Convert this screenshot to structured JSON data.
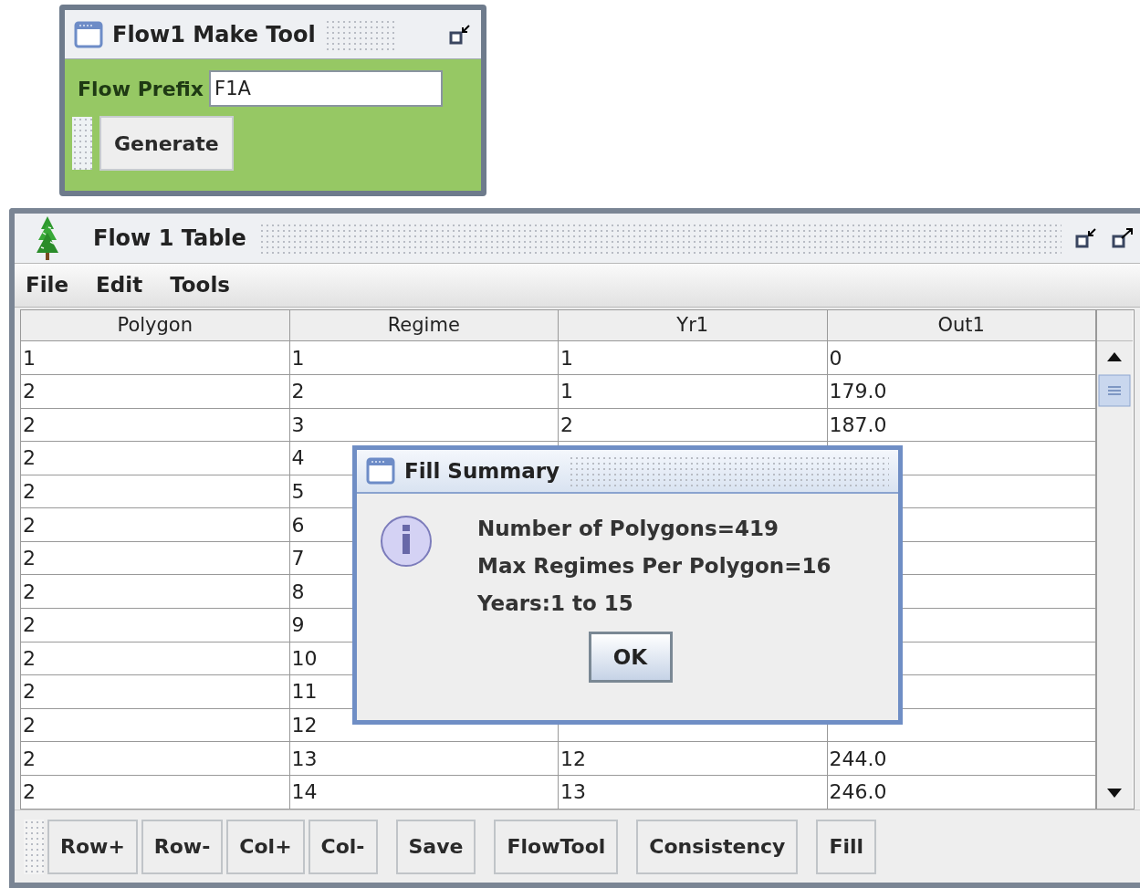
{
  "make_tool": {
    "title": "Flow1 Make Tool",
    "prefix_label": "Flow Prefix",
    "prefix_value": "F1A",
    "button": "Generate"
  },
  "table_window": {
    "title": "Flow 1 Table",
    "menu": [
      "File",
      "Edit",
      "Tools"
    ],
    "columns": [
      "Polygon",
      "Regime",
      "Yr1",
      "Out1"
    ],
    "rows": [
      [
        "1",
        "1",
        "1",
        "0"
      ],
      [
        "2",
        "2",
        "1",
        "179.0"
      ],
      [
        "2",
        "3",
        "2",
        "187.0"
      ],
      [
        "2",
        "4"
      ],
      [
        "2",
        "5"
      ],
      [
        "2",
        "6"
      ],
      [
        "2",
        "7"
      ],
      [
        "2",
        "8"
      ],
      [
        "2",
        "9"
      ],
      [
        "2",
        "10"
      ],
      [
        "2",
        "11"
      ],
      [
        "2",
        "12"
      ],
      [
        "2",
        "13",
        "12",
        "244.0"
      ],
      [
        "2",
        "14",
        "13",
        "246.0"
      ]
    ],
    "toolbar_groups": [
      [
        "Row+",
        "Row-",
        "Col+",
        "Col-"
      ],
      [
        "Save"
      ],
      [
        "FlowTool"
      ],
      [
        "Consistency"
      ],
      [
        "Fill"
      ]
    ]
  },
  "dialog": {
    "title": "Fill Summary",
    "lines": [
      "Number of Polygons=419",
      "Max Regimes Per Polygon=16",
      "Years:1 to 15"
    ],
    "button": "OK"
  }
}
